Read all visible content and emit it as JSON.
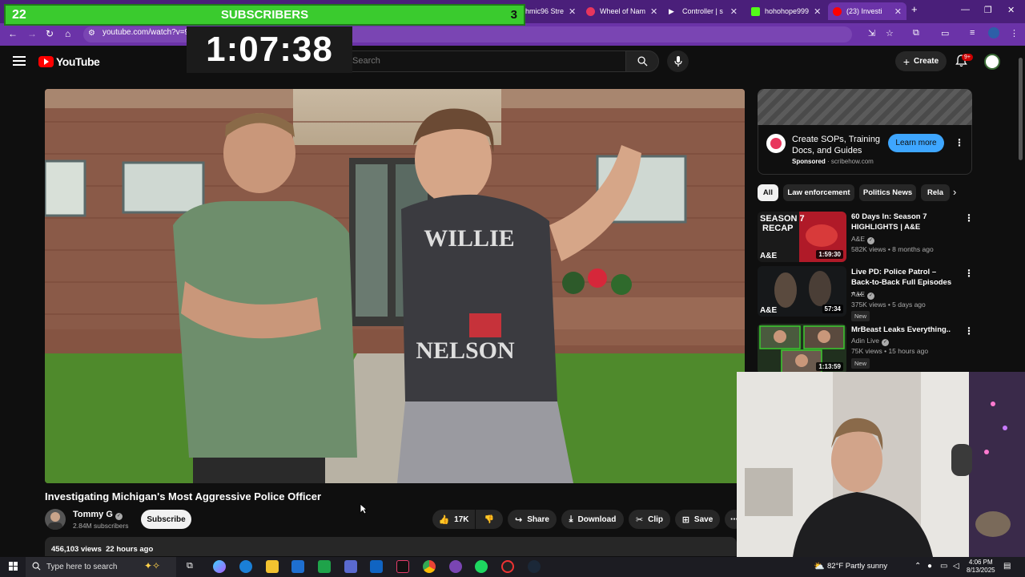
{
  "browser": {
    "tabs": [
      {
        "label": "hmic96 Stre",
        "color": "#7a45b3"
      },
      {
        "label": "Wheel of Nam",
        "color": "#e8365d"
      },
      {
        "label": "Controller | s",
        "color": "#6b33a8"
      },
      {
        "label": "hohohope999",
        "color": "#53fc18"
      },
      {
        "label": "(23) Investi",
        "color": "#ff0000"
      }
    ],
    "url": "youtube.com/watch?v=9("
  },
  "overlay": {
    "sub_left": "22",
    "sub_center": "SUBSCRIBERS",
    "sub_right": "3",
    "timer": "1:07:38"
  },
  "header": {
    "logo_text": "YouTube",
    "search_placeholder": "Search",
    "create_label": "Create",
    "notification_count": "9+"
  },
  "video": {
    "title": "Investigating Michigan's Most Aggressive Police Officer",
    "channel": "Tommy G",
    "subscribers": "2.84M subscribers",
    "subscribe_label": "Subscribe",
    "likes": "17K",
    "share_label": "Share",
    "download_label": "Download",
    "clip_label": "Clip",
    "save_label": "Save",
    "views": "456,103 views",
    "age": "22 hours ago",
    "shirt_line1": "WILLIE",
    "shirt_line2": "NELSON"
  },
  "ad": {
    "title": "Create SOPs, Training Docs, and Guides",
    "sponsored": "Sponsored",
    "domain": "scribehow.com",
    "cta": "Learn more"
  },
  "chips": [
    "All",
    "Law enforcement",
    "Politics News",
    "Rela"
  ],
  "recommendations": [
    {
      "title": "60 Days In: Season 7 HIGHLIGHTS | A&E",
      "channel": "A&E",
      "meta": "582K views • 8 months ago",
      "duration": "1:59:30",
      "thumb_text": "SEASON 7",
      "thumb_text2": "RECAP",
      "logo": "A&E",
      "badge": ""
    },
    {
      "title": "Live PD: Police Patrol – Back-to-Back Full Episodes – ...",
      "channel": "A&E",
      "meta": "375K views • 5 days ago",
      "duration": "57:34",
      "thumb_text": "",
      "thumb_text2": "",
      "logo": "A&E",
      "badge": "New"
    },
    {
      "title": "MrBeast Leaks Everything..",
      "channel": "Adin Live",
      "meta": "75K views • 15 hours ago",
      "duration": "1:13:59",
      "thumb_text": "",
      "thumb_text2": "",
      "logo": "",
      "badge": "New"
    }
  ],
  "taskbar": {
    "search_text": "Type here to search",
    "weather": "82°F  Partly sunny",
    "time": "4:06 PM",
    "date": "8/13/2025"
  }
}
